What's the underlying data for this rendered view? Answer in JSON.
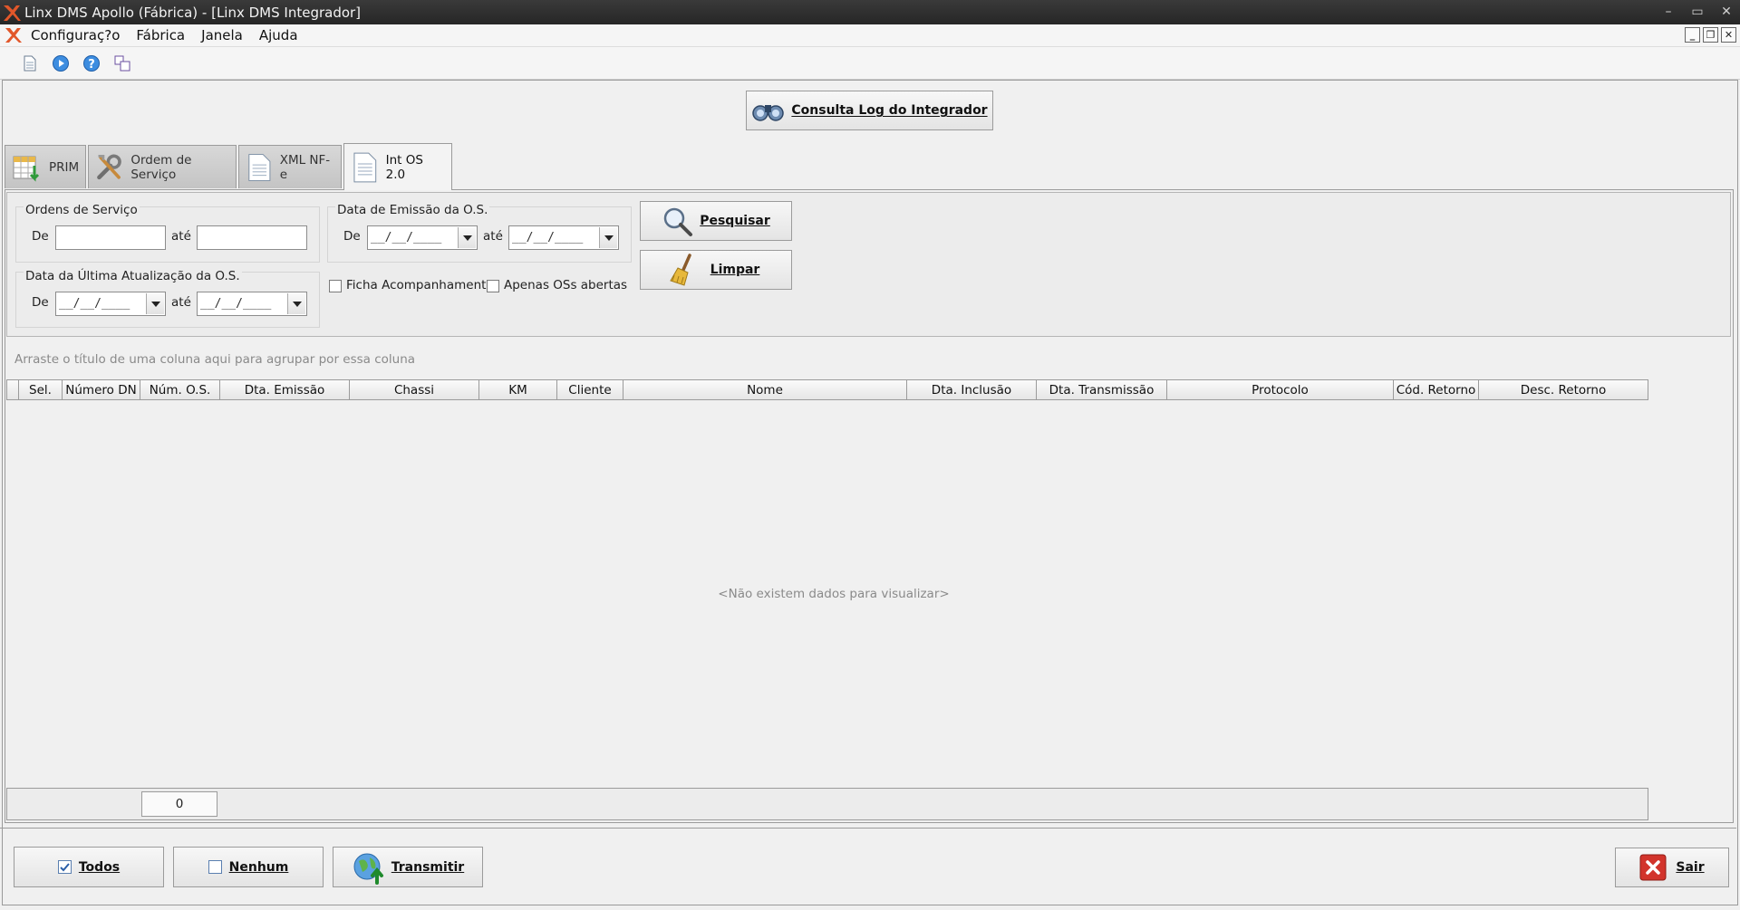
{
  "window": {
    "title": "Linx DMS Apollo (Fábrica) - [Linx DMS Integrador]",
    "controls": [
      "–",
      "▭",
      "✕"
    ]
  },
  "menu": {
    "items": [
      "Configuraç?o",
      "Fábrica",
      "Janela",
      "Ajuda"
    ]
  },
  "toolbar": {
    "icons": [
      "document-icon",
      "play-icon",
      "help-icon",
      "window-tile-icon"
    ]
  },
  "consulta_button": {
    "label": "Consulta Log do Integrador"
  },
  "tabs": [
    {
      "label": "PRIM",
      "icon": "table-arrow-icon",
      "active": false
    },
    {
      "label": "Ordem de Serviço",
      "icon": "tools-icon",
      "active": false
    },
    {
      "label": "XML NF-e",
      "icon": "document-icon",
      "active": false
    },
    {
      "label": "Int OS 2.0",
      "icon": "document-icon",
      "active": true
    }
  ],
  "filters": {
    "ordens_group": "Ordens de Serviço",
    "emissao_group": "Data de Emissão da O.S.",
    "atualizacao_group": "Data da Última Atualização da O.S.",
    "de_label": "De",
    "ate_label": "até",
    "date_placeholder": "__/__/____",
    "ordem_de_value": "",
    "ordem_ate_value": "",
    "ficha_label": "Ficha Acompanhamento",
    "apenas_label": "Apenas OSs abertas",
    "ficha_checked": false,
    "apenas_checked": false
  },
  "actions": {
    "pesquisar": "Pesquisar",
    "limpar": "Limpar"
  },
  "grid": {
    "grouping_hint": "Arraste o título de uma coluna aqui para agrupar por essa coluna",
    "columns": [
      "Sel.",
      "Número DN",
      "Núm. O.S.",
      "Dta. Emissão",
      "Chassi",
      "KM",
      "Cliente",
      "Nome",
      "Dta. Inclusão",
      "Dta. Transmissão",
      "Protocolo",
      "Cód. Retorno",
      "Desc. Retorno"
    ],
    "empty_text": "<Não existem dados para visualizar>",
    "count": "0"
  },
  "bottom": {
    "todos": "Todos",
    "nenhum": "Nenhum",
    "transmitir": "Transmitir",
    "sair": "Sair"
  },
  "colors": {
    "titlebar": "#2e2e2e",
    "accent_red": "#c0392b"
  }
}
